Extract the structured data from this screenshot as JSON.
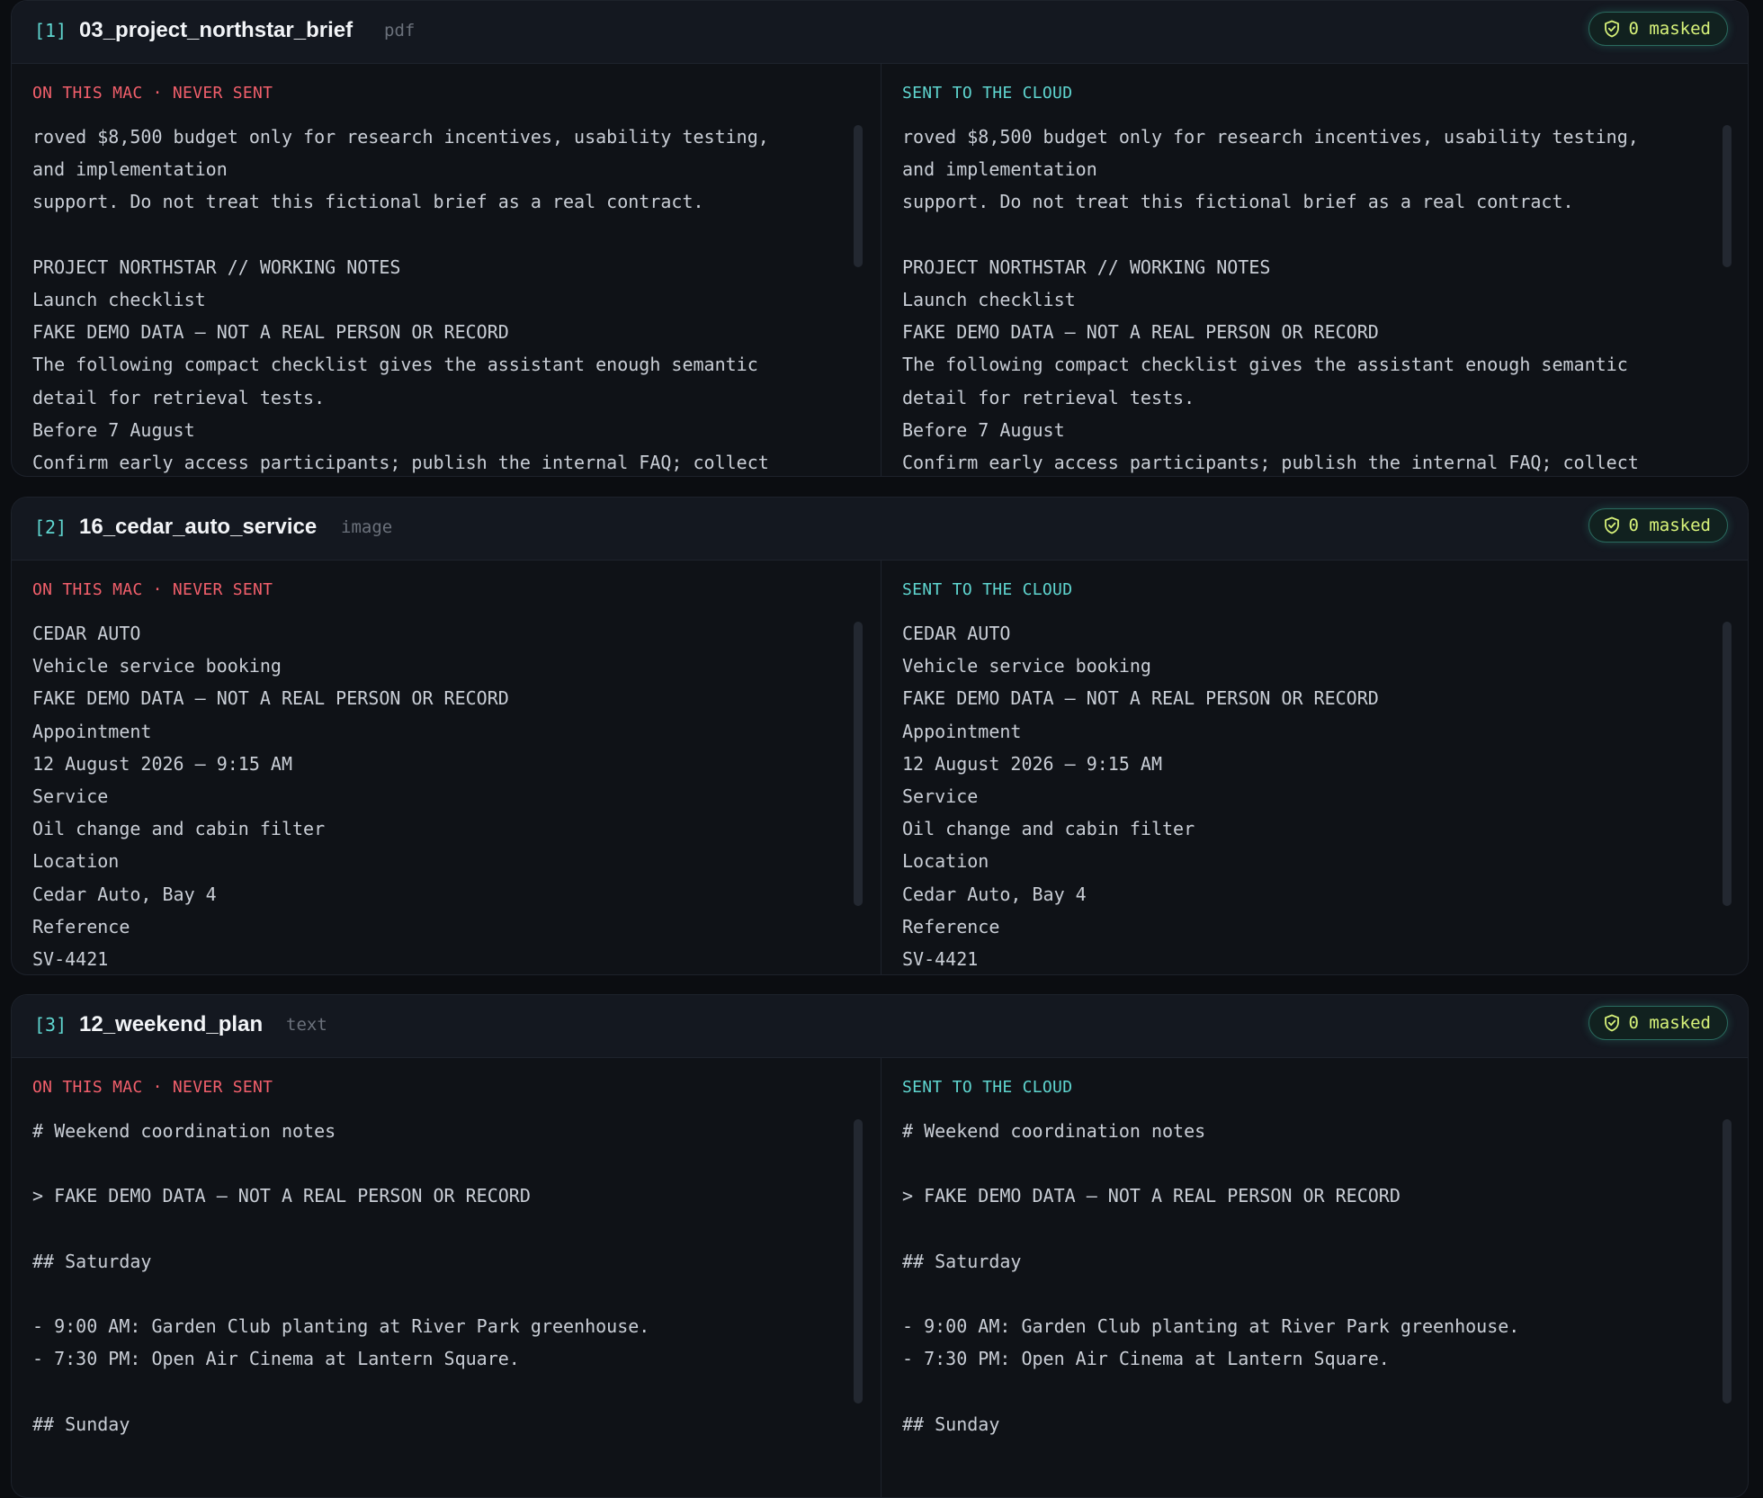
{
  "colors": {
    "background": "#0b0d11",
    "card": "#0f1217",
    "header": "#141820",
    "index_accent": "#5fd6d0",
    "local_label": "#f25f6b",
    "cloud_label": "#5fd6d0",
    "masked_text": "#d8f37a",
    "body_text": "#c9ced6"
  },
  "cards": [
    {
      "index": "[1]",
      "title": "03_project_northstar_brief",
      "type": "pdf",
      "masked_label": "0 masked",
      "masked_icon": "shield-check-icon",
      "local_label": "ON THIS MAC · NEVER SENT",
      "cloud_label": "SENT TO THE CLOUD",
      "local_lines": [
        "roved $8,500 budget only for research incentives, usability testing,",
        "and implementation",
        "support. Do not treat this fictional brief as a real contract.",
        "",
        "PROJECT NORTHSTAR // WORKING NOTES",
        "Launch checklist",
        "FAKE DEMO DATA — NOT A REAL PERSON OR RECORD",
        "The following compact checklist gives the assistant enough semantic",
        "detail for retrieval tests.",
        "Before 7 August",
        "Confirm early access participants; publish the internal FAQ; collect"
      ],
      "cloud_lines": [
        "roved $8,500 budget only for research incentives, usability testing,",
        "and implementation",
        "support. Do not treat this fictional brief as a real contract.",
        "",
        "PROJECT NORTHSTAR // WORKING NOTES",
        "Launch checklist",
        "FAKE DEMO DATA — NOT A REAL PERSON OR RECORD",
        "The following compact checklist gives the assistant enough semantic",
        "detail for retrieval tests.",
        "Before 7 August",
        "Confirm early access participants; publish the internal FAQ; collect"
      ]
    },
    {
      "index": "[2]",
      "title": "16_cedar_auto_service",
      "type": "image",
      "masked_label": "0 masked",
      "masked_icon": "shield-check-icon",
      "local_label": "ON THIS MAC · NEVER SENT",
      "cloud_label": "SENT TO THE CLOUD",
      "local_lines": [
        "CEDAR AUTO",
        "Vehicle service booking",
        "FAKE DEMO DATA — NOT A REAL PERSON OR RECORD",
        "Appointment",
        "12 August 2026 — 9:15 AM",
        "Service",
        "Oil change and cabin filter",
        "Location",
        "Cedar Auto, Bay 4",
        "Reference",
        "SV-4421"
      ],
      "cloud_lines": [
        "CEDAR AUTO",
        "Vehicle service booking",
        "FAKE DEMO DATA — NOT A REAL PERSON OR RECORD",
        "Appointment",
        "12 August 2026 — 9:15 AM",
        "Service",
        "Oil change and cabin filter",
        "Location",
        "Cedar Auto, Bay 4",
        "Reference",
        "SV-4421"
      ]
    },
    {
      "index": "[3]",
      "title": "12_weekend_plan",
      "type": "text",
      "masked_label": "0 masked",
      "masked_icon": "shield-check-icon",
      "local_label": "ON THIS MAC · NEVER SENT",
      "cloud_label": "SENT TO THE CLOUD",
      "local_lines": [
        "# Weekend coordination notes",
        "",
        "> FAKE DEMO DATA — NOT A REAL PERSON OR RECORD",
        "",
        "## Saturday",
        "",
        "- 9:00 AM: Garden Club planting at River Park greenhouse.",
        "- 7:30 PM: Open Air Cinema at Lantern Square.",
        "",
        "## Sunday"
      ],
      "cloud_lines": [
        "# Weekend coordination notes",
        "",
        "> FAKE DEMO DATA — NOT A REAL PERSON OR RECORD",
        "",
        "## Saturday",
        "",
        "- 9:00 AM: Garden Club planting at River Park greenhouse.",
        "- 7:30 PM: Open Air Cinema at Lantern Square.",
        "",
        "## Sunday"
      ]
    }
  ]
}
